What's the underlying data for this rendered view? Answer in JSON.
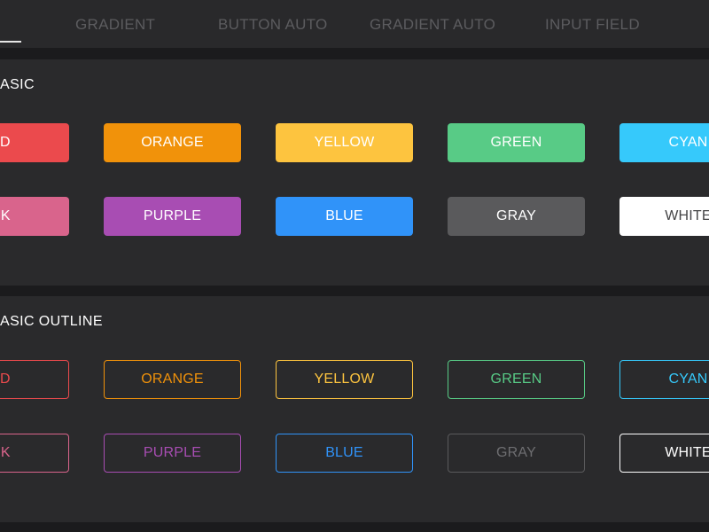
{
  "tabs": [
    {
      "label": ""
    },
    {
      "label": "GRADIENT"
    },
    {
      "label": "BUTTON AUTO"
    },
    {
      "label": "GRADIENT AUTO"
    },
    {
      "label": "INPUT FIELD"
    }
  ],
  "sections": {
    "basic": {
      "title": "ASIC"
    },
    "outline": {
      "title": "ASIC  OUTLINE"
    }
  },
  "basic_buttons": {
    "row1": [
      {
        "label": "ED",
        "color": "#eb4a4d"
      },
      {
        "label": "ORANGE",
        "color": "#f1920a"
      },
      {
        "label": "YELLOW",
        "color": "#fdc43f"
      },
      {
        "label": "GREEN",
        "color": "#58cb86"
      },
      {
        "label": "CYAN",
        "color": "#36c9fb"
      }
    ],
    "row2": [
      {
        "label": "NK",
        "color": "#d9648c"
      },
      {
        "label": "PURPLE",
        "color": "#a84db3"
      },
      {
        "label": "BLUE",
        "color": "#3093f9"
      },
      {
        "label": "GRAY",
        "color": "#5a5a5c"
      },
      {
        "label": "WHITE",
        "color": "#ffffff"
      }
    ]
  },
  "outline_buttons": {
    "row1": [
      {
        "label": "ED",
        "color": "#eb4a4d"
      },
      {
        "label": "ORANGE",
        "color": "#f1920a"
      },
      {
        "label": "YELLOW",
        "color": "#fdc43f"
      },
      {
        "label": "GREEN",
        "color": "#58cb86"
      },
      {
        "label": "CYAN",
        "color": "#36c9fb"
      }
    ],
    "row2": [
      {
        "label": "NK",
        "color": "#d9648c"
      },
      {
        "label": "PURPLE",
        "color": "#a84db3"
      },
      {
        "label": "BLUE",
        "color": "#3093f9"
      },
      {
        "label": "GRAY",
        "color": "#5a5a5c"
      },
      {
        "label": "WHITE",
        "color": "#ffffff"
      }
    ]
  }
}
